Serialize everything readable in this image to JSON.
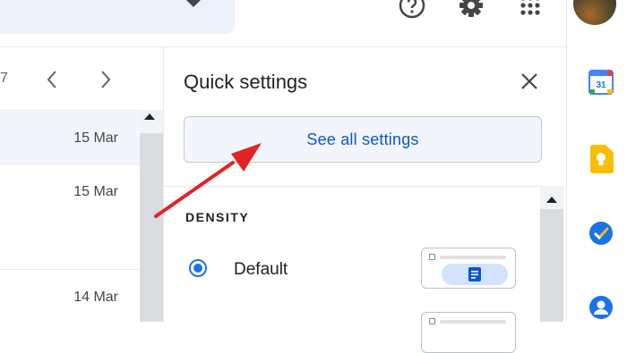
{
  "pagination": {
    "range_suffix": "7"
  },
  "mail_rows": [
    {
      "date": "15 Mar"
    },
    {
      "date": "15 Mar"
    },
    {
      "date": "14 Mar"
    }
  ],
  "quick_settings": {
    "title": "Quick settings",
    "see_all_label": "See all settings",
    "density": {
      "heading": "DENSITY",
      "options": [
        {
          "label": "Default",
          "selected": true
        }
      ]
    }
  },
  "icons": {
    "top": [
      "help-icon",
      "gear-icon",
      "apps-icon"
    ],
    "side": [
      "calendar-icon",
      "keep-icon",
      "tasks-icon",
      "contacts-icon"
    ]
  },
  "calendar_icon_text": "31",
  "colors": {
    "accent": "#0b57d0",
    "radio": "#1a73e8",
    "annotation_arrow": "#e02424",
    "button_bg": "#f2f6fc"
  }
}
